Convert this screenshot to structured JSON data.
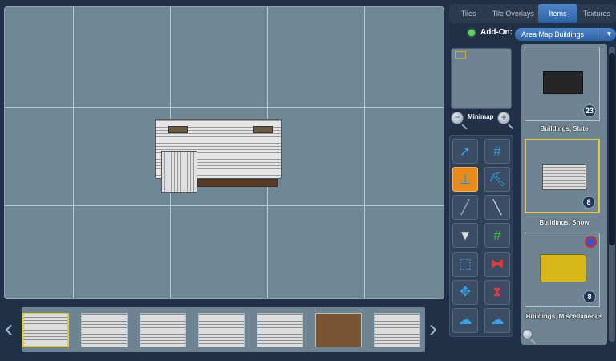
{
  "tabs": [
    {
      "label": "Tiles"
    },
    {
      "label": "Tile Overlays"
    },
    {
      "label": "Items",
      "active": true
    },
    {
      "label": "Textures"
    }
  ],
  "addon": {
    "label": "Add-On:",
    "selected": "Area Map Buildings",
    "status_color": "#6bd25a"
  },
  "minimap": {
    "label": "Minimap"
  },
  "tools": [
    "select-pointer",
    "grid",
    "stamp",
    "excavator",
    "brush",
    "magic-wand",
    "paint-bucket",
    "grid-overlay",
    "selection-rect",
    "flip-horizontal",
    "move",
    "flip-vertical-rotate",
    "cloud-import",
    "cloud-export"
  ],
  "active_tool": "stamp",
  "items": [
    {
      "label": "Buildings, Slate",
      "count": "23"
    },
    {
      "label": "Buildings, Snow",
      "count": "8",
      "selected": true
    },
    {
      "label": "Buildings, Miscellaneous",
      "count": "8",
      "blocked_icon": true
    }
  ],
  "variants": {
    "count": 7,
    "selected_index": 0
  },
  "accent_color": "#e0cc30"
}
